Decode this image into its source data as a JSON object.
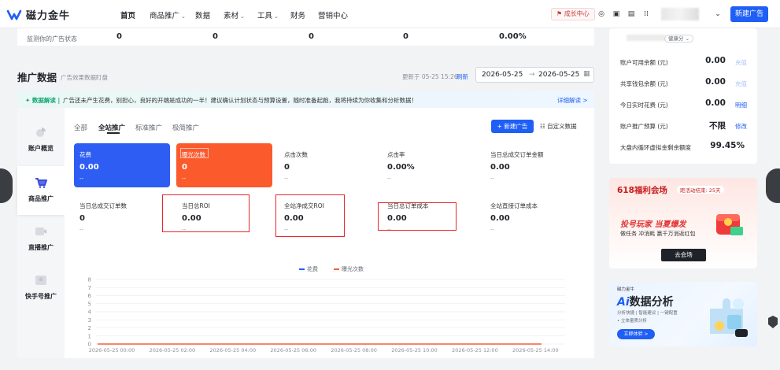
{
  "brand": {
    "name": "磁力金牛"
  },
  "nav": {
    "items": [
      {
        "label": "首页",
        "chevron": false
      },
      {
        "label": "商品推广",
        "chevron": true
      },
      {
        "label": "数据",
        "chevron": false
      },
      {
        "label": "素材",
        "chevron": true
      },
      {
        "label": "工具",
        "chevron": true
      },
      {
        "label": "财务",
        "chevron": false
      },
      {
        "label": "营销中心",
        "chevron": false
      }
    ],
    "growth_center": "成长中心",
    "new_ad": "新建广告"
  },
  "status_strip": {
    "label": "监测你的广告状态",
    "values": [
      "0",
      "0",
      "0",
      "0",
      "0.00%"
    ]
  },
  "promo": {
    "title": "推广数据",
    "subtitle": "广告效果数据盯盘",
    "update_time": "更新于 05-25 15:26",
    "refresh": "刷新",
    "date_start": "2026-05-25",
    "date_sep": "→",
    "date_end": "2026-05-25"
  },
  "tip": {
    "tag": "数据解读",
    "text": "广告还未产生花费，别担心，良好的开端是成功的一半！建议确认计划状态与预算设置，随时准备起跑，我将持续为你收集和分析数据！",
    "link": "详细解读 >"
  },
  "side_tabs": [
    "账户概览",
    "商品推广",
    "直播推广",
    "快手号推广"
  ],
  "tabs": [
    "全部",
    "全站推广",
    "标准推广",
    "极简推广"
  ],
  "buttons": {
    "new_ad": "+ 新建广告",
    "custom": "自定义数据"
  },
  "metrics_row1": [
    {
      "label": "花费",
      "value": "0.00",
      "dash": "--"
    },
    {
      "label": "曝光次数",
      "value": "0",
      "dash": "--"
    },
    {
      "label": "点击次数",
      "value": "0",
      "dash": "--"
    },
    {
      "label": "点击率",
      "value": "0.00%",
      "dash": "--"
    },
    {
      "label": "当日总成交订单金额",
      "value": "0.00",
      "dash": "--"
    }
  ],
  "metrics_row2": [
    {
      "label": "当日总成交订单数",
      "value": "0",
      "dash": "--"
    },
    {
      "label": "当日总ROI",
      "value": "0.00",
      "dash": "--"
    },
    {
      "label": "全站净成交ROI",
      "value": "0.00",
      "dash": "--"
    },
    {
      "label": "当日总订单成本",
      "value": "0.00",
      "dash": "--"
    },
    {
      "label": "全站直接订单成本",
      "value": "0.00",
      "dash": "--"
    }
  ],
  "chart_data": {
    "type": "line",
    "x": [
      "2026-05-25 00:00",
      "2026-05-25 02:00",
      "2026-05-25 04:00",
      "2026-05-25 06:00",
      "2026-05-25 08:00",
      "2026-05-25 10:00",
      "2026-05-25 12:00",
      "2026-05-25 14:00"
    ],
    "y_ticks": [
      0,
      1,
      2,
      3,
      4,
      5,
      6,
      7,
      8
    ],
    "ylim": [
      0,
      8
    ],
    "series": [
      {
        "name": "花费",
        "color": "#2e5df4",
        "values": [
          0,
          0,
          0,
          0,
          0,
          0,
          0,
          0
        ]
      },
      {
        "name": "曝光次数",
        "color": "#f0603b",
        "values": [
          0,
          0,
          0,
          0,
          0,
          0,
          0,
          0
        ]
      }
    ],
    "grid": true,
    "legend": "top-center"
  },
  "account": {
    "badge": "健康分",
    "rows": [
      {
        "label": "账户可用余额 (元)",
        "value": "0.00",
        "link": "充值",
        "faint": true
      },
      {
        "label": "共享钱包余额 (元)",
        "value": "0.00",
        "link": "充值",
        "faint": true
      },
      {
        "label": "今日实时花费 (元)",
        "value": "0.00",
        "link": "明细",
        "faint": false
      },
      {
        "label": "账户推广预算 (元)",
        "value": "不限",
        "link": "修改",
        "faint": false
      },
      {
        "label": "大盘内循环虚拟金剩余额度",
        "value": "99.45%",
        "link": "",
        "faint": false
      }
    ]
  },
  "banner_618": {
    "title": "618福利会场",
    "countdown": "距活动结束: 25天",
    "headline": "投号玩家 当夏爆发",
    "sub": "做任务 冲消耗 赢千万消返红包",
    "button": "去会场"
  },
  "banner_ai": {
    "tag": "磁力金牛",
    "title_ai": "Ai",
    "title_rest": "数据分析",
    "sub": "分析快捷  |  智能建议  |  一键配置",
    "sub2": "• 立体量质分析",
    "button": "立即体验 >"
  },
  "colors": {
    "accent": "#1f5ff5",
    "highlight_box": "#e8262b"
  }
}
